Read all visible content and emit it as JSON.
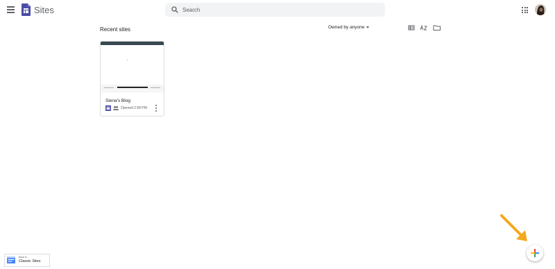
{
  "header": {
    "app_title": "Sites",
    "search": {
      "placeholder": "Search",
      "value": ""
    },
    "menu_icon": "hamburger-menu-icon",
    "apps_icon": "apps-grid-icon",
    "avatar_icon": "account-avatar"
  },
  "main": {
    "section_title": "Recent sites",
    "owner_filter": "Owned by anyone",
    "view_tools": [
      "list-view-icon",
      "sort-az-icon",
      "folder-icon"
    ],
    "sites": [
      {
        "title": "Siena's Blog",
        "opened": "Opened 2:58 PM"
      }
    ]
  },
  "classic_link": {
    "small": "Back to",
    "label": "Classic Sites"
  },
  "colors": {
    "sites_brand": "#4b4ca6",
    "annotation_arrow": "#f4a81d",
    "fab_plus": [
      "#ea4335",
      "#4285f4",
      "#34a853",
      "#fbbc04"
    ]
  }
}
